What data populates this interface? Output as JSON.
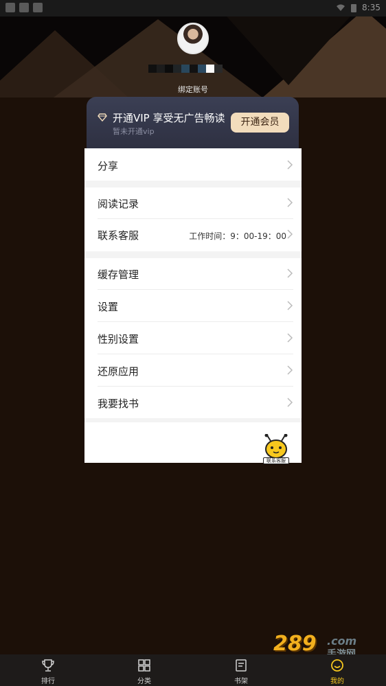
{
  "status_bar": {
    "time": "8:35"
  },
  "profile": {
    "bind_account_label": "绑定账号",
    "avatar_icon": "avatar-photo"
  },
  "vip": {
    "title": "开通VIP 享受无广告畅读",
    "subtitle": "暂未开通vip",
    "button_label": "开通会员",
    "icon": "diamond-icon",
    "accent": "#f2dcbc"
  },
  "menu": {
    "share": {
      "label": "分享"
    },
    "history": {
      "label": "阅读记录"
    },
    "support": {
      "label": "联系客服",
      "hours": "工作时间：9：00-19：00"
    },
    "cache": {
      "label": "缓存管理"
    },
    "settings": {
      "label": "设置"
    },
    "gender": {
      "label": "性别设置"
    },
    "reset": {
      "label": "还原应用"
    },
    "request": {
      "label": "我要找书"
    }
  },
  "floating_support": {
    "label": "联系客服",
    "icon": "bee-mascot-icon"
  },
  "watermark": {
    "number": "289",
    "domain": ".com",
    "text": "手游网"
  },
  "tabs": [
    {
      "label": "排行",
      "icon": "trophy-icon",
      "active": false
    },
    {
      "label": "分类",
      "icon": "grid-icon",
      "active": false
    },
    {
      "label": "书架",
      "icon": "book-icon",
      "active": false
    },
    {
      "label": "我的",
      "icon": "smile-icon",
      "active": true
    }
  ],
  "colors": {
    "background": "#1c1008",
    "tab_active": "#f7c81e"
  }
}
